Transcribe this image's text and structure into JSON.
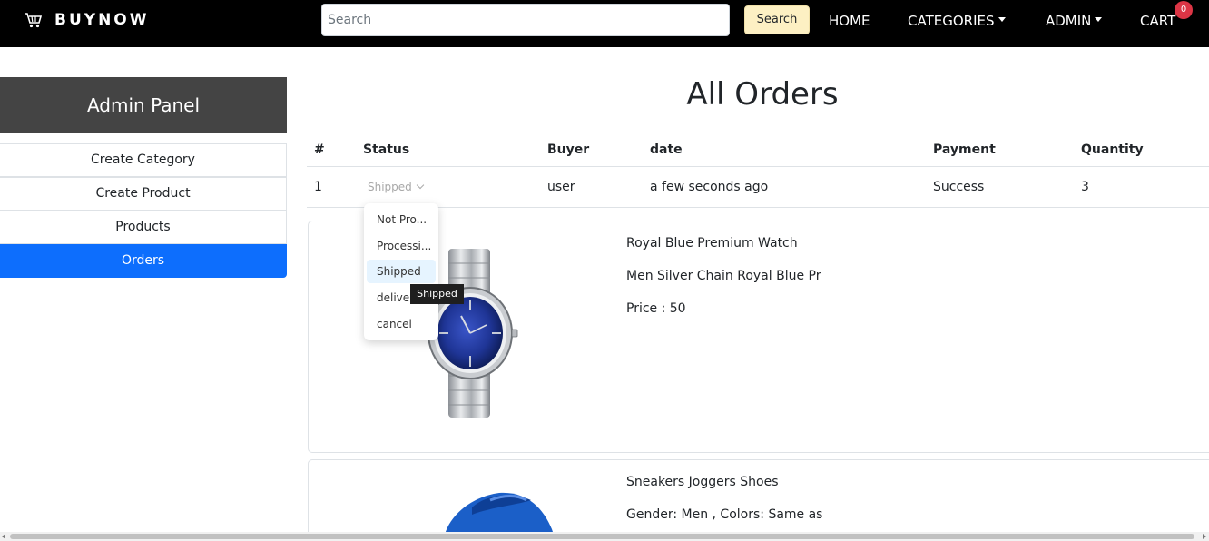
{
  "navbar": {
    "brand": "BUYNOW",
    "brand_icon": "shopping-cart-icon",
    "search_placeholder": "Search",
    "search_button": "Search",
    "links": {
      "home": "HOME",
      "categories": "CATEGORIES",
      "admin": "ADMIN",
      "cart": "CART"
    },
    "cart_count": "0"
  },
  "sidebar": {
    "title": "Admin Panel",
    "items": [
      {
        "label": "Create Category"
      },
      {
        "label": "Create Product"
      },
      {
        "label": "Products"
      },
      {
        "label": "Orders",
        "active": true
      }
    ]
  },
  "main": {
    "title": "All Orders",
    "table": {
      "headers": [
        "#",
        "Status",
        "Buyer",
        "date",
        "Payment",
        "Quantity"
      ],
      "row": {
        "index": "1",
        "status": "Shipped",
        "buyer": "user",
        "date": "a few seconds ago",
        "payment": "Success",
        "quantity": "3"
      }
    },
    "status_dropdown": {
      "options": [
        "Not Pro...",
        "Processi...",
        "Shipped",
        "deliver",
        "cancel"
      ],
      "selected": "Shipped",
      "tooltip": "Shipped"
    },
    "products": [
      {
        "name": "Royal Blue Premium Watch",
        "description": "Men Silver Chain Royal Blue Pr",
        "price": "Price : 50",
        "image_icon": "watch-image"
      },
      {
        "name": "Sneakers Joggers Shoes",
        "description": "Gender: Men , Colors: Same as",
        "image_icon": "sneaker-image"
      }
    ]
  },
  "colors": {
    "navbar": "#000000",
    "accent": "#0d6efd",
    "search_button": "#fdf0c3",
    "badge": "#dc3545",
    "panel_header": "#444444"
  }
}
